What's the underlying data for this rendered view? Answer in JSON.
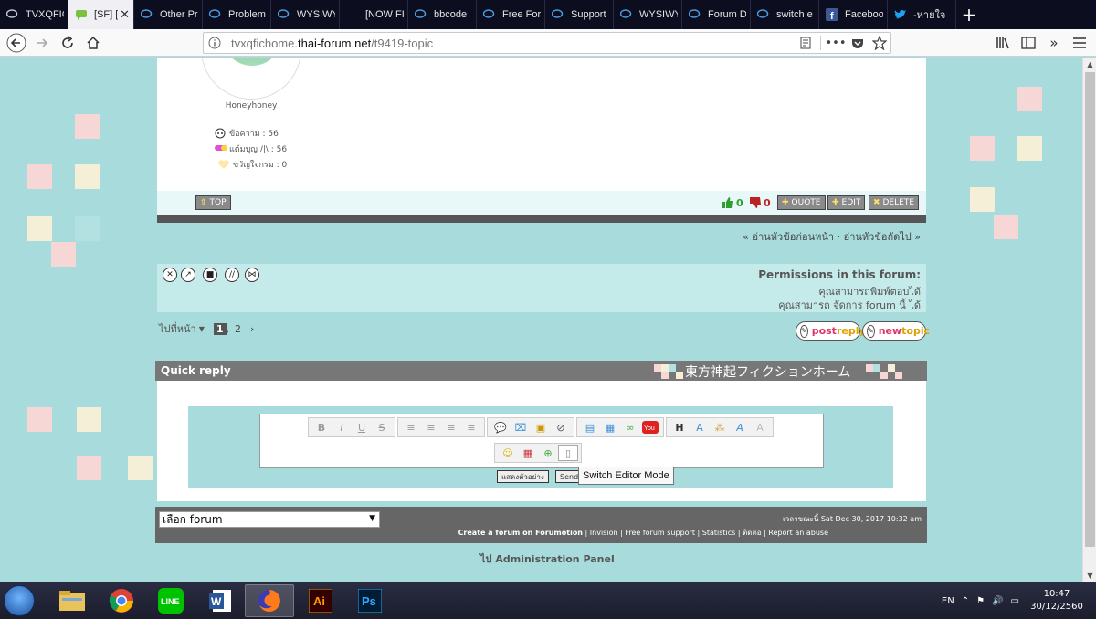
{
  "browser": {
    "tabs": [
      {
        "label": "TVXQFIC",
        "icon": "forum-icon"
      },
      {
        "label": "[SF] [",
        "icon": "chat-icon",
        "active": true
      },
      {
        "label": "Other Pr",
        "icon": "forum-icon"
      },
      {
        "label": "Problem",
        "icon": "forum-icon"
      },
      {
        "label": "WYSIWY",
        "icon": "forum-icon"
      },
      {
        "label": "[NOW FI",
        "icon": "none"
      },
      {
        "label": "bbcode",
        "icon": "forum-icon"
      },
      {
        "label": "Free For",
        "icon": "forum-icon"
      },
      {
        "label": "Support",
        "icon": "forum-icon"
      },
      {
        "label": "WYSIWY",
        "icon": "forum-icon"
      },
      {
        "label": "Forum D",
        "icon": "forum-icon"
      },
      {
        "label": "switch e",
        "icon": "forum-icon"
      },
      {
        "label": "Faceboo",
        "icon": "facebook-icon"
      },
      {
        "label": "-หายใจ",
        "icon": "twitter-icon"
      }
    ],
    "new_tab": "+",
    "url_host": "tvxqfichome.",
    "url_domain": "thai-forum.net",
    "url_path": "/t9419-topic"
  },
  "post": {
    "username": "Honeyhoney",
    "stats": [
      {
        "label": "ข้อความ : 56",
        "icon": "message-count-icon"
      },
      {
        "label": "แต้มบุญ /|\\ : 56",
        "icon": "points-icon"
      },
      {
        "label": "ขวัญใจกรม : 0",
        "icon": "heart-icon"
      }
    ],
    "top_label": "TOP",
    "likes": "0",
    "dislikes": "0",
    "quote_label": "QUOTE",
    "edit_label": "EDIT",
    "delete_label": "DELETE"
  },
  "nav_topics": {
    "prev": "« อ่านหัวข้อก่อนหน้า",
    "sep": "·",
    "next": "อ่านหัวข้อถัดไป »"
  },
  "permissions": {
    "title": "Permissions in this forum:",
    "lines": [
      "คุณสามารถพิมพ์ตอบได้",
      "คุณสามารถ จัดการ forum นี้ ได้"
    ]
  },
  "pagination": {
    "jump_label": "ไปที่หน้า",
    "current": "1",
    "separator": ",",
    "other": "2",
    "next": "›"
  },
  "buttons": {
    "postreply_1": "post",
    "postreply_2": "reply",
    "newtopic_1": "new",
    "newtopic_2": "topic"
  },
  "quick_reply": {
    "title": "Quick reply",
    "banner": "東方神起フィクションホーム",
    "preview_btn": "แสดงตัวอย่าง",
    "send_btn": "Send",
    "tooltip": "Switch Editor Mode"
  },
  "footer": {
    "forum_select": "เลือก forum",
    "time_text": "เวลาขณะนี้ Sat Dec 30, 2017 10:32 am",
    "links": [
      "Create a forum on Forumotion",
      "Invision",
      "Free forum support",
      "Statistics",
      "ติดต่อ",
      "Report an abuse"
    ],
    "link_sep": " | ",
    "admin": "ไป Administration Panel"
  },
  "taskbar": {
    "lang": "EN",
    "time": "10:47",
    "date": "30/12/2560",
    "apps": [
      "file-explorer-icon",
      "chrome-icon",
      "line-icon",
      "word-icon",
      "firefox-icon",
      "illustrator-icon",
      "photoshop-icon"
    ],
    "ai_label": "Ai",
    "ps_label": "Ps",
    "line_label": "LINE",
    "word_label": "W"
  },
  "colors": {
    "page_bg": "#a8dcdc",
    "header_gray": "#777777",
    "reply_pink": "#e0336c",
    "reply_orange": "#e0a000"
  }
}
